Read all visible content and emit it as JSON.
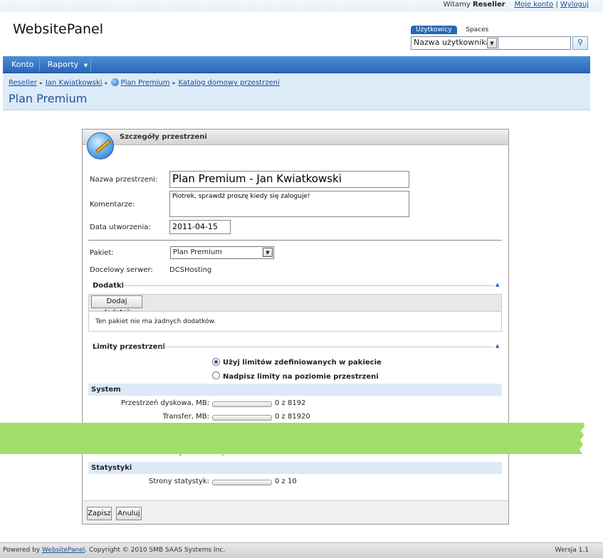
{
  "topbar": {
    "welcome_prefix": "Witamy",
    "user": "Reseller",
    "my_account": "Moje konto",
    "separator": "|",
    "logout": "Wyloguj"
  },
  "brand": {
    "logo": "WebsitePanel"
  },
  "search": {
    "tab_users": "Użytkowicy",
    "tab_spaces": "Spaces",
    "field_selected": "Nazwa użytkownika",
    "query": "",
    "button_icon": "search-icon"
  },
  "nav": {
    "items": [
      "Konto",
      "Raporty"
    ],
    "dropdown_icon": "caret-down-icon"
  },
  "breadcrumb": {
    "items": [
      "Reseller",
      "Jan Kwiatkowski",
      "Plan Premium",
      "Katalog domowy przestrzeni"
    ]
  },
  "page": {
    "title": "Plan Premium"
  },
  "panel": {
    "title": "Szczegóły przestrzeni",
    "fields": {
      "name_label": "Nazwa przestrzeni:",
      "name_value": "Plan Premium - Jan Kwiatkowski",
      "comments_label": "Komentarze:",
      "comments_value": "Piotrek, sprawdź proszę kiedy się zaloguje!",
      "created_label": "Data utworzenia:",
      "created_value": "2011-04-15",
      "package_label": "Pakiet:",
      "package_value": "Plan Premium",
      "server_label": "Docelowy serwer:",
      "server_value": "DCSHosting"
    },
    "addons": {
      "heading": "Dodatki",
      "add_button": "Dodaj dodatek",
      "empty_text": "Ten pakiet nie ma żadnych dodatków."
    },
    "limits": {
      "heading": "Limity przestrzeni",
      "option_package": "Użyj limitów zdefiniowanych w pakiecie",
      "option_override": "Nadpisz limity na poziomie przestrzeni",
      "selected": "option_package"
    },
    "groups": [
      {
        "name": "System",
        "quotas": [
          {
            "label": "Przestrzeń dyskowa, MB:",
            "used": 0,
            "max": 8192,
            "text": "0 z 8192"
          },
          {
            "label": "Transfer, MB:",
            "used": 0,
            "max": 81920,
            "text": "0 z 81920"
          }
        ]
      },
      {
        "name": "Statystyki",
        "quotas": [
          {
            "label": "Strony statystyk:",
            "used": 0,
            "max": 10,
            "text": "0 z 10"
          }
        ]
      }
    ],
    "partial_obscured_text": "Edytor DNS: Włączone",
    "save_button": "Zapisz",
    "cancel_button": "Anuluj"
  },
  "footer": {
    "powered_prefix": "Powered by",
    "powered_link": "WebsitePanel",
    "copyright": ". Copyright © 2010 SMB SAAS Systems Inc.",
    "version": "Wersja 1.1"
  },
  "colors": {
    "accent": "#2a66b8",
    "crumb_bg": "#dcebf8",
    "banner": "#9fdf6a"
  }
}
